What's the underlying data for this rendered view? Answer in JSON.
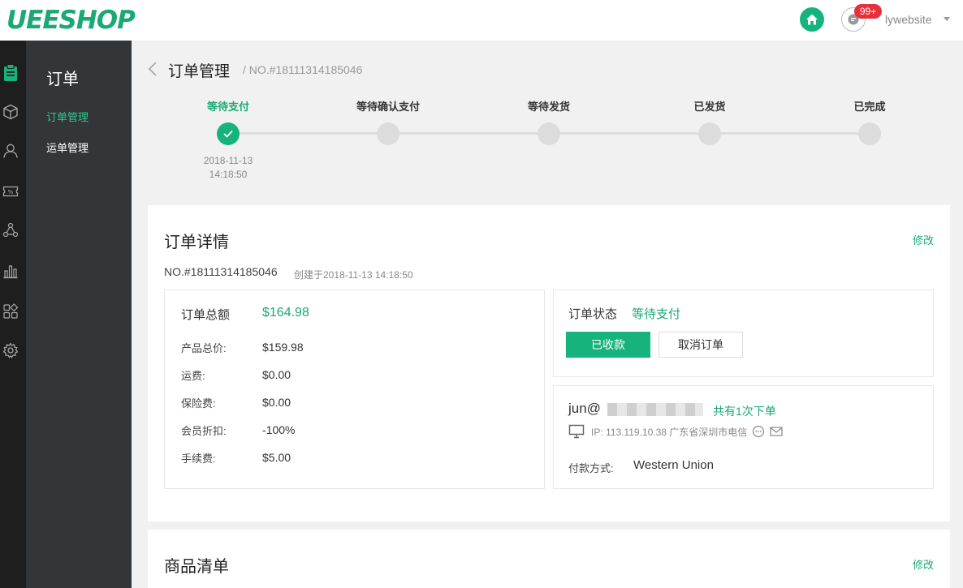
{
  "app": {
    "logo": "UEESHOP"
  },
  "topbar": {
    "badge": "99+",
    "username": "lywebsite"
  },
  "rail": {
    "icons": [
      "clipboard-icon",
      "box-icon",
      "user-icon",
      "coupon-icon",
      "share-icon",
      "chart-icon",
      "apps-icon",
      "gear-icon"
    ]
  },
  "submenu": {
    "title": "订单",
    "items": [
      {
        "label": "订单管理",
        "active": true
      },
      {
        "label": "运单管理",
        "active": false
      }
    ]
  },
  "header": {
    "title": "订单管理",
    "order_no": "/ NO.#18111314185046"
  },
  "steps": [
    {
      "label": "等待支付",
      "done": true,
      "date": "2018-11-13",
      "time": "14:18:50"
    },
    {
      "label": "等待确认支付",
      "done": false
    },
    {
      "label": "等待发货",
      "done": false
    },
    {
      "label": "已发货",
      "done": false
    },
    {
      "label": "已完成",
      "done": false
    }
  ],
  "order_detail": {
    "title": "订单详情",
    "edit": "修改",
    "order_no": "NO.#18111314185046",
    "created": "创建于2018-11-13 14:18:50",
    "total_label": "订单总额",
    "total_value": "$164.98",
    "fees": [
      {
        "label": "产品总价:",
        "value": "$159.98"
      },
      {
        "label": "运费:",
        "value": "$0.00"
      },
      {
        "label": "保险费:",
        "value": "$0.00"
      },
      {
        "label": "会员折扣:",
        "value": "-100%"
      },
      {
        "label": "手续费:",
        "value": "$5.00"
      }
    ],
    "status_label": "订单状态",
    "status_value": "等待支付",
    "btn_received": "已收款",
    "btn_cancel": "取消订单",
    "customer_email": "jun@",
    "orders_count": "共有1次下单",
    "ip": "IP: 113.119.10.38 广东省深圳市电信",
    "pay_label": "付款方式:",
    "pay_value": "Western Union"
  },
  "product_list": {
    "title": "商品清单",
    "edit": "修改"
  },
  "colors": {
    "accent": "#16b47c",
    "badge": "#e8303c",
    "sidebar": "#333638",
    "rail": "#1e1e1e"
  }
}
